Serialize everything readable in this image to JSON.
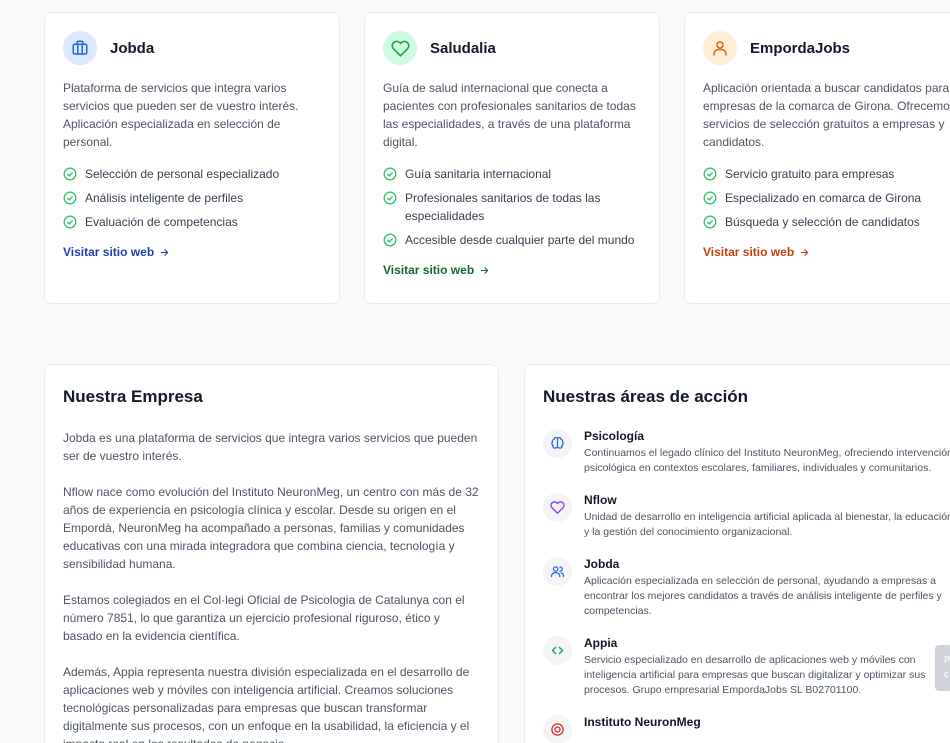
{
  "products": [
    {
      "name": "Jobda",
      "description": "Plataforma de servicios que integra varios servicios que pueden ser de vuestro interés. Aplicación especializada en selección de personal.",
      "features": [
        "Selección de personal especializado",
        "Análisis inteligente de perfiles",
        "Evaluación de competencias"
      ],
      "link": "Visitar sitio web",
      "accent": "#1e40af",
      "icon_bg": "#dbeafe",
      "icon": "briefcase-icon"
    },
    {
      "name": "Saludalia",
      "description": "Guía de salud internacional que conecta a pacientes con profesionales sanitarios de todas las especialidades, a través de una plataforma digital.",
      "features": [
        "Guía sanitaria internacional",
        "Profesionales sanitarios de todas las especialidades",
        "Accesible desde cualquier parte del mundo"
      ],
      "link": "Visitar sitio web",
      "accent": "#166534",
      "icon_bg": "#d1fae5",
      "icon": "heart-icon"
    },
    {
      "name": "EmpordaJobs",
      "description": "Aplicación orientada a buscar candidatos para empresas de la comarca de Girona. Ofrecemos servicios de selección gratuitos a empresas y candidatos.",
      "features": [
        "Servicio gratuito para empresas",
        "Especializado en comarca de Girona",
        "Búsqueda y selección de candidatos"
      ],
      "link": "Visitar sitio web",
      "accent": "#c2410c",
      "icon_bg": "#ffedd5",
      "icon": "user-icon"
    }
  ],
  "company": {
    "title": "Nuestra Empresa",
    "paragraphs": [
      "Jobda es una plataforma de servicios que integra varios servicios que pueden ser de vuestro interés.",
      "Nflow nace como evolución del Instituto NeuronMeg, un centro con más de 32 años de experiencia en psicología clínica y escolar. Desde su origen en el Empordà, NeuronMeg ha acompañado a personas, familias y comunidades educativas con una mirada integradora que combina ciencia, tecnología y sensibilidad humana.",
      "Estamos colegiados en el Col·legi Oficial de Psicologia de Catalunya con el número 7851, lo que garantiza un ejercicio profesional riguroso, ético y basado en la evidencia científica.",
      "Además, Appia representa nuestra división especializada en el desarrollo de aplicaciones web y móviles con inteligencia artificial. Creamos soluciones tecnológicas personalizadas para empresas que buscan transformar digitalmente sus procesos, con un enfoque en la usabilidad, la eficiencia y el impacto real en los resultados de negocio."
    ]
  },
  "areas": {
    "title": "Nuestras áreas de acción",
    "items": [
      {
        "name": "Psicología",
        "description": "Continuamos el legado clínico del Instituto NeuronMeg, ofreciendo intervención psicológica en contextos escolares, familiares, individuales y comunitarios.",
        "icon": "brain-icon",
        "color": "#2563eb"
      },
      {
        "name": "Nflow",
        "description": "Unidad de desarrollo en inteligencia artificial aplicada al bienestar, la educación y la gestión del conocimiento organizacional.",
        "icon": "heart-icon",
        "color": "#9333ea"
      },
      {
        "name": "Jobda",
        "description": "Aplicación especializada en selección de personal, ayudando a empresas a encontrar los mejores candidatos a través de análisis inteligente de perfiles y competencias.",
        "icon": "users-icon",
        "color": "#2563eb"
      },
      {
        "name": "Appia",
        "description": "Servicio especializado en desarrollo de aplicaciones web y móviles con inteligencia artificial para empresas que buscan digitalizar y optimizar sus procesos. Grupo empresarial EmpordaJobs SL B02701100.",
        "icon": "code-icon",
        "color": "#16a34a"
      },
      {
        "name": "Instituto NeuronMeg",
        "description": "",
        "icon": "target-icon",
        "color": "#dc2626"
      }
    ]
  },
  "floating_tab": {
    "line1": "P",
    "line2": "c"
  }
}
